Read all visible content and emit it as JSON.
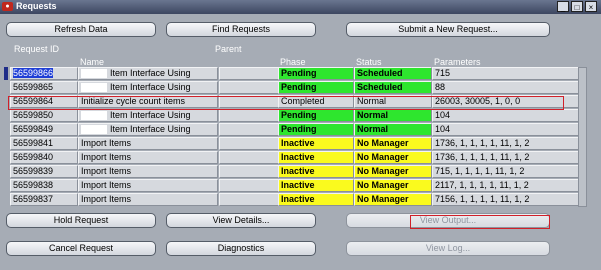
{
  "window": {
    "title": "Requests",
    "controls": [
      "_",
      "□",
      "×"
    ]
  },
  "toolbar": {
    "refresh": "Refresh Data",
    "find": "Find Requests",
    "submit": "Submit a New Request..."
  },
  "columns": {
    "request_id": "Request ID",
    "name": "Name",
    "parent": "Parent",
    "phase": "Phase",
    "status": "Status",
    "parameters": "Parameters"
  },
  "rows": [
    {
      "id": "56599866",
      "name": "Item Interface Using",
      "masked": true,
      "parent": "",
      "phase": "Pending",
      "status": "Scheduled",
      "params": "715",
      "phase_color": "green",
      "status_color": "green",
      "selected": true
    },
    {
      "id": "56599865",
      "name": "Item Interface Using",
      "masked": true,
      "parent": "",
      "phase": "Pending",
      "status": "Scheduled",
      "params": "88",
      "phase_color": "green",
      "status_color": "green"
    },
    {
      "id": "56599864",
      "name": "Initialize cycle count items",
      "masked": false,
      "parent": "",
      "phase": "Completed",
      "status": "Normal",
      "params": "26003, 30005, 1, 0, 0",
      "phase_color": "",
      "status_color": ""
    },
    {
      "id": "56599850",
      "name": "Item Interface Using",
      "masked": true,
      "parent": "",
      "phase": "Pending",
      "status": "Normal",
      "params": "104",
      "phase_color": "green",
      "status_color": "green"
    },
    {
      "id": "56599849",
      "name": "Item Interface Using",
      "masked": true,
      "parent": "",
      "phase": "Pending",
      "status": "Normal",
      "params": "104",
      "phase_color": "green",
      "status_color": "green"
    },
    {
      "id": "56599841",
      "name": "Import Items",
      "masked": false,
      "parent": "",
      "phase": "Inactive",
      "status": "No Manager",
      "params": "1736, 1, 1, 1, 1, 11, 1, 2",
      "phase_color": "yellow",
      "status_color": "yellow"
    },
    {
      "id": "56599840",
      "name": "Import Items",
      "masked": false,
      "parent": "",
      "phase": "Inactive",
      "status": "No Manager",
      "params": "1736, 1, 1, 1, 1, 11, 1, 2",
      "phase_color": "yellow",
      "status_color": "yellow"
    },
    {
      "id": "56599839",
      "name": "Import Items",
      "masked": false,
      "parent": "",
      "phase": "Inactive",
      "status": "No Manager",
      "params": "715, 1, 1, 1, 1, 11, 1, 2",
      "phase_color": "yellow",
      "status_color": "yellow"
    },
    {
      "id": "56599838",
      "name": "Import Items",
      "masked": false,
      "parent": "",
      "phase": "Inactive",
      "status": "No Manager",
      "params": "2117, 1, 1, 1, 1, 11, 1, 2",
      "phase_color": "yellow",
      "status_color": "yellow"
    },
    {
      "id": "56599837",
      "name": "Import Items",
      "masked": false,
      "parent": "",
      "phase": "Inactive",
      "status": "No Manager",
      "params": "7156, 1, 1, 1, 1, 11, 1, 2",
      "phase_color": "yellow",
      "status_color": "yellow"
    }
  ],
  "actions": {
    "hold": "Hold Request",
    "view_details": "View Details...",
    "view_output": "View Output...",
    "cancel": "Cancel Request",
    "diagnostics": "Diagnostics",
    "view_log": "View Log..."
  },
  "colors": {
    "pending": "#2ee62e",
    "inactive": "#fafa1e",
    "highlight": "#d0202a",
    "selection": "#1f3fd6"
  }
}
